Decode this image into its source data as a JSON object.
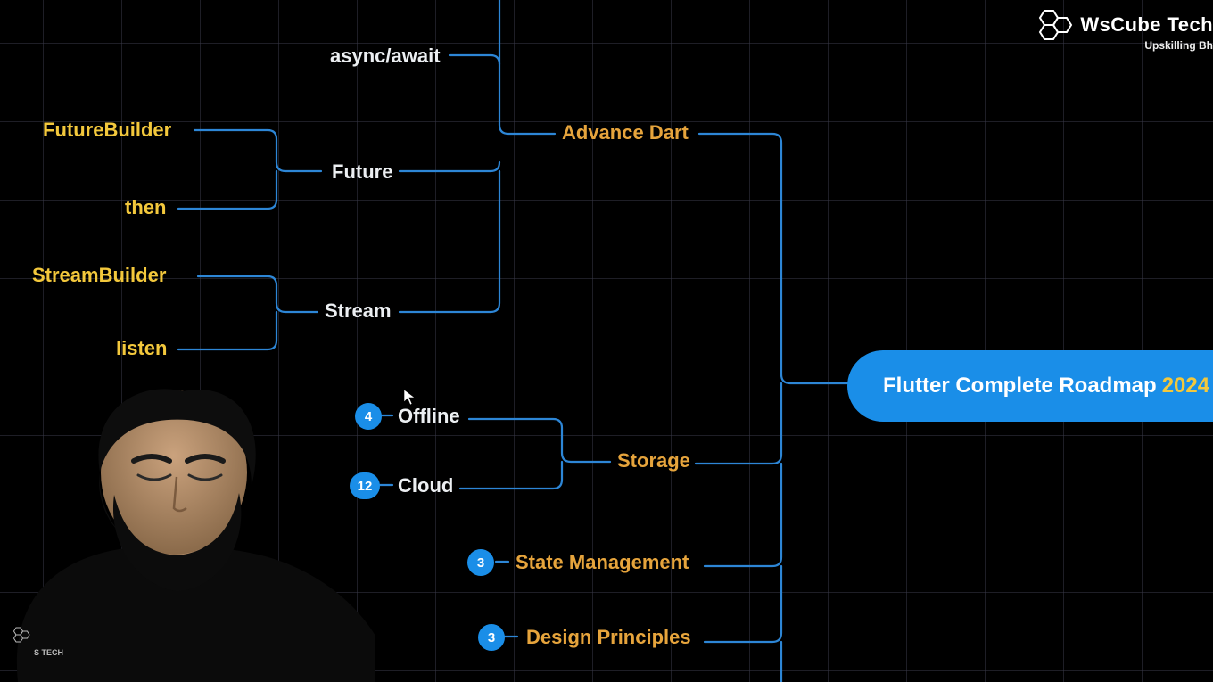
{
  "root": {
    "title": "Flutter Complete Roadmap",
    "year": "2024"
  },
  "branches": {
    "advance_dart": {
      "label": "Advance Dart",
      "children": {
        "async_await": "async/await",
        "future": {
          "label": "Future",
          "children": {
            "future_builder": "FutureBuilder",
            "then": "then"
          }
        },
        "stream": {
          "label": "Stream",
          "children": {
            "stream_builder": "StreamBuilder",
            "listen": "listen"
          }
        }
      }
    },
    "storage": {
      "label": "Storage",
      "children": {
        "offline": {
          "label": "Offline",
          "count": "4"
        },
        "cloud": {
          "label": "Cloud",
          "count": "12"
        }
      }
    },
    "state_management": {
      "label": "State Management",
      "count": "3"
    },
    "design_principles": {
      "label": "Design Principles",
      "count": "3"
    }
  },
  "logo": {
    "brand": "WsCube Tech",
    "tagline": "Upskilling Bh"
  }
}
